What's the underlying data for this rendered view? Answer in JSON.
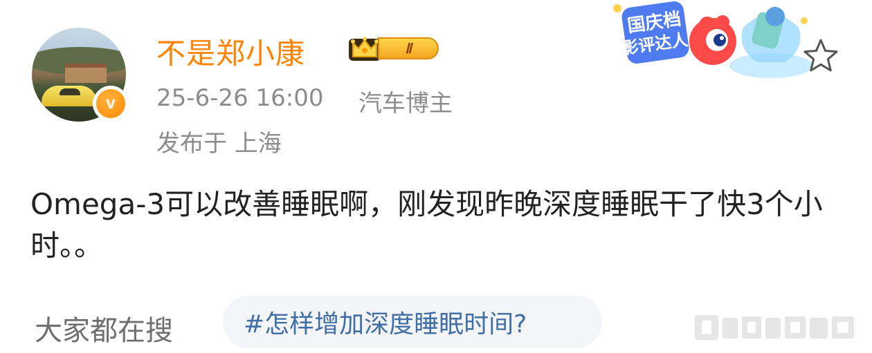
{
  "user": {
    "name": "不是郑小康",
    "level_badge": "Ⅱ",
    "verified_mark": "v"
  },
  "meta": {
    "time": "25-6-26 16:00",
    "tag": "汽车博主",
    "location": "发布于 上海"
  },
  "decoration": {
    "label_line1": "国庆档",
    "label_line2": "影评达人"
  },
  "post": {
    "text": "Omega-3可以改善睡眠啊，刚发现昨晚深度睡眠干了快3个小时。。"
  },
  "search": {
    "label": "大家都在搜",
    "topic": "#怎样增加深度睡眠时间?"
  },
  "icons": {
    "star": "star-outline-icon",
    "crown": "crown-icon",
    "verified": "verified-v-icon"
  },
  "colors": {
    "username": "#ff8200",
    "meta": "#8c8c8c",
    "body": "#222222",
    "topic": "#3f6fa6",
    "topic_bg": "#f4f5f8"
  }
}
